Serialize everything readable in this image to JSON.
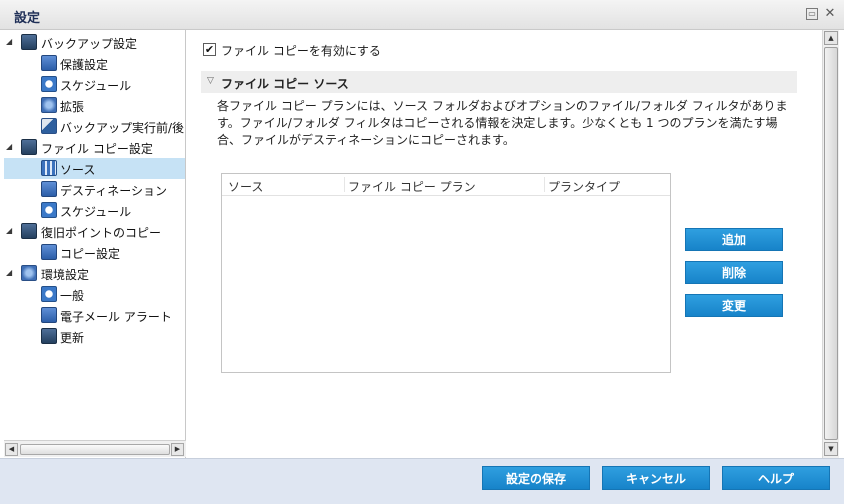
{
  "window": {
    "title": "設定",
    "restore_glyph": "▭",
    "close_glyph": "✕"
  },
  "tree": {
    "items": [
      {
        "label": "バックアップ設定",
        "icon": "backup-settings-icon",
        "level": 0,
        "expander": "◢"
      },
      {
        "label": "保護設定",
        "icon": "protection-icon",
        "level": 1
      },
      {
        "label": "スケジュール",
        "icon": "schedule-clock-icon",
        "level": 1
      },
      {
        "label": "拡張",
        "icon": "advanced-gear-icon",
        "level": 1
      },
      {
        "label": "バックアップ実行前/後の",
        "icon": "pre-post-tool-icon",
        "level": 1
      },
      {
        "label": "ファイル コピー設定",
        "icon": "file-copy-settings-icon",
        "level": 0,
        "expander": "◢"
      },
      {
        "label": "ソース",
        "icon": "source-network-icon",
        "level": 1,
        "selected": true
      },
      {
        "label": "デスティネーション",
        "icon": "destination-icon",
        "level": 1
      },
      {
        "label": "スケジュール",
        "icon": "schedule-clock-icon",
        "level": 1
      },
      {
        "label": "復旧ポイントのコピー",
        "icon": "recovery-point-copy-icon",
        "level": 0,
        "expander": "◢"
      },
      {
        "label": "コピー設定",
        "icon": "copy-settings-icon",
        "level": 1
      },
      {
        "label": "環境設定",
        "icon": "preferences-gear-icon",
        "level": 0,
        "expander": "◢"
      },
      {
        "label": "一般",
        "icon": "general-globe-icon",
        "level": 1
      },
      {
        "label": "電子メール アラート",
        "icon": "email-alert-icon",
        "level": 1
      },
      {
        "label": "更新",
        "icon": "update-arrows-icon",
        "level": 1
      }
    ]
  },
  "content": {
    "enable_checkbox": {
      "label": "ファイル コピーを有効にする",
      "checked": true,
      "glyph": "✔"
    },
    "section": {
      "title": "ファイル コピー ソース",
      "collapse_glyph": "▽"
    },
    "description": "各ファイル コピー プランには、ソース フォルダおよびオプションのファイル/フォルダ フィルタがあります。ファイル/フォルダ フィルタはコピーされる情報を決定します。少なくとも 1 つのプランを満たす場合、ファイルがデスティネーションにコピーされます。",
    "table": {
      "columns": [
        "ソース",
        "ファイル コピー プラン",
        "プランタイプ"
      ]
    },
    "buttons": {
      "add": "追加",
      "delete": "削除",
      "modify": "変更"
    }
  },
  "scroll": {
    "left": "◀",
    "right": "▶",
    "up": "▲",
    "down": "▼"
  },
  "footer": {
    "save": "設定の保存",
    "cancel": "キャンセル",
    "help": "ヘルプ"
  },
  "colors": {
    "accent_button": "#1783c9",
    "selected_row": "#c6e2f5",
    "footer_bg": "#dfe6f2"
  }
}
